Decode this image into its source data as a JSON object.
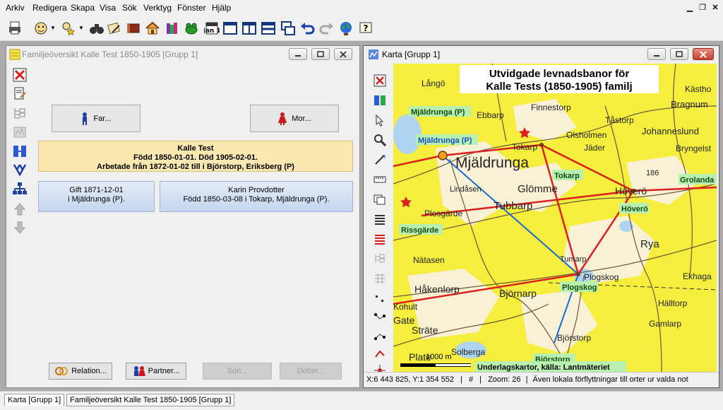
{
  "menubar": {
    "items": [
      "Arkiv",
      "Redigera",
      "Skapa",
      "Visa",
      "Sök",
      "Verktyg",
      "Fönster",
      "Hjälp"
    ]
  },
  "toolbar": {
    "icons": [
      "print-icon",
      "person-face-icon",
      "person-star-icon",
      "binoculars-icon",
      "notes-icon",
      "book-icon",
      "home-icon",
      "books-icon",
      "frog-icon",
      "calendar-icon",
      "layout-single-icon",
      "layout-columns-icon",
      "layout-rows-icon",
      "cascade-windows-icon",
      "undo-icon",
      "redo-icon",
      "globe-icon",
      "help-icon"
    ],
    "calendar_text": "Jan 1"
  },
  "family_window": {
    "title": "Familjeöversikt Kalle Test 1850-1905 [Grupp 1]",
    "father_button": "Far...",
    "mother_button": "Mor...",
    "main_person": {
      "name": "Kalle Test",
      "born_died": "Född 1850-01-01. Död 1905-02-01.",
      "work": "Arbetade från 1872-01-02 till  i Björstorp, Eriksberg (P)"
    },
    "marriage": {
      "line1": "Gift 1871-12-01",
      "line2": "i Mjäldrunga (P)."
    },
    "spouse": {
      "name": "Karin Provdotter",
      "born": "Född 1850-03-08 i Tokarp, Mjäldrunga (P)."
    },
    "buttons": {
      "relation": "Relation...",
      "partner": "Partner...",
      "son": "Son...",
      "daughter": "Dotter..."
    },
    "accent_color": "#fbe7b0"
  },
  "map_window": {
    "title": "Karta [Grupp 1]",
    "map_title_line1": "Utvidgade levnadsbanor för",
    "map_title_line2": "Kalle Tests  (1850-1905) familj",
    "big_place": "Mjäldrunga",
    "highlight_labels": {
      "mjaldrunga_p1": "Mjäldrunga (P)",
      "mjaldrunga_p2": "Mjäldrunga (P)",
      "tokarp": "Tokarp",
      "grolanda": "Grolanda",
      "hovero": "Höverö",
      "rissgarde": "Rissgärde",
      "plogskog": "Plogskog",
      "bjorstorp": "Björstorp"
    },
    "place_names": {
      "lango": "Långö",
      "ebbarp": "Ebbarp",
      "finnestorp": "Finnestorp",
      "olsholmen": "Olsholmen",
      "tokarp": "Tokarp",
      "jader": "Jäder",
      "bragnum": "Bragnum",
      "tastorp": "Tåstorp",
      "johanneslund": "Johanneslund",
      "kastho": "Kästho",
      "bryngelst": "Bryngelst",
      "lindasen": "Lindåsen",
      "glomme": "Glömme",
      "hovero": "Höverö",
      "tubbarp": "Tubbarp",
      "plosgarde": "Plosgärde",
      "rya": "Rya",
      "natasen": "Nätasen",
      "tumarp": "Tumarp",
      "plogskog": "Plogskog",
      "hakenlorp": "Håkenlorp",
      "bjornarp": "Björnarp",
      "ekhaga": "Ekhaga",
      "kohult": "Kohult",
      "gate": "Gate",
      "hulltorp": "Hälltorp",
      "strate": "Sträte",
      "gamlarp": "Gamlarp",
      "bjorstorp": "Björstorp",
      "solberga": "Solberga",
      "number": "186"
    },
    "scale_text": "1000 m",
    "plate_text": "Plate",
    "credit": "Underlagskartor, källa: Lantmäteriet",
    "status": {
      "coords": "X:6 443 825, Y:1 354 552",
      "mark": "#",
      "zoom": "Zoom: 26",
      "note": "Även lokala förflyttningar till orter ur valda not"
    },
    "colors": {
      "map_yellow": "#f5ee3c",
      "map_cream": "#f8f1d6",
      "route_red": "#dc1f1f",
      "route_blue": "#1e6ad6",
      "label_green": "#b8f0b0"
    }
  },
  "taskbar": {
    "tabs": [
      "Karta [Grupp 1]",
      "Familjeöversikt Kalle Test 1850-1905 [Grupp 1]"
    ]
  }
}
